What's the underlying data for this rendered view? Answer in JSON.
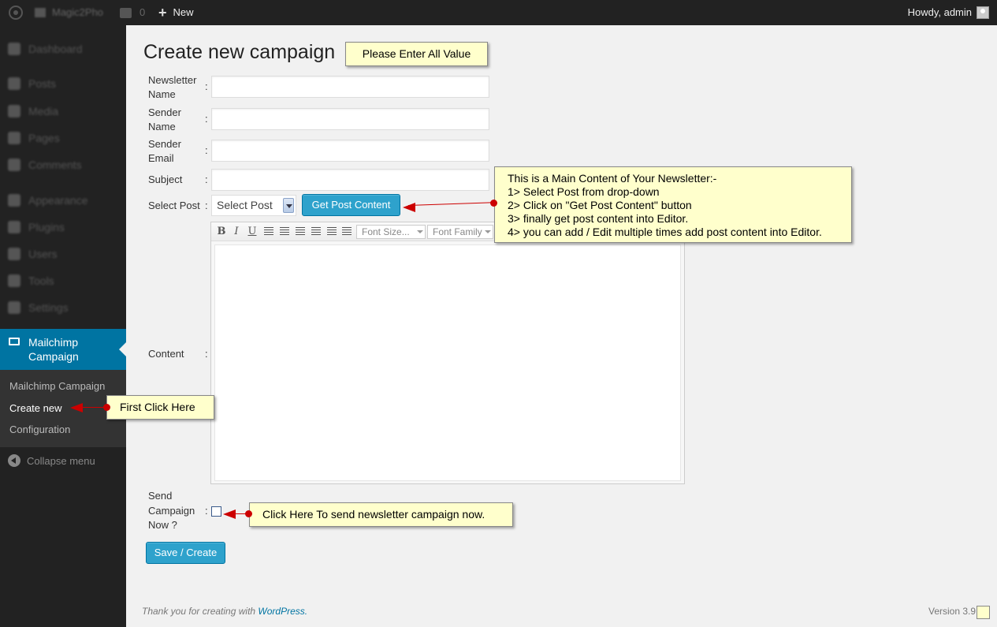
{
  "adminbar": {
    "site_name": "Magic2Pho",
    "comments_count": "0",
    "new_label": "New",
    "greeting": "Howdy, admin"
  },
  "sidebar": {
    "items": [
      {
        "label": "Dashboard"
      },
      {
        "label": "Posts"
      },
      {
        "label": "Media"
      },
      {
        "label": "Pages"
      },
      {
        "label": "Comments"
      },
      {
        "label": "Appearance"
      },
      {
        "label": "Plugins"
      },
      {
        "label": "Users"
      },
      {
        "label": "Tools"
      },
      {
        "label": "Settings"
      }
    ],
    "active": {
      "label": "Mailchimp Campaign"
    },
    "submenu": [
      {
        "label": "Mailchimp Campaign"
      },
      {
        "label": "Create new"
      },
      {
        "label": "Configuration"
      }
    ],
    "collapse_label": "Collapse menu"
  },
  "page": {
    "title": "Create new campaign",
    "fields": {
      "newsletter_name_label": "Newsletter Name",
      "sender_name_label": "Sender Name",
      "sender_email_label": "Sender Email",
      "subject_label": "Subject",
      "select_post_label": "Select Post",
      "content_label": "Content",
      "send_now_label": "Send Campaign Now ?",
      "colon": ":"
    },
    "select_post_value": "Select Post",
    "get_post_button": "Get Post Content",
    "save_button": "Save / Create",
    "editor": {
      "bold": "B",
      "italic": "I",
      "underline": "U",
      "font_size": "Font Size...",
      "font_family": "Font Family"
    }
  },
  "callouts": {
    "enter_all": "Please Enter All Value",
    "main_content": [
      "This is a Main Content of Your Newsletter:-",
      "1> Select Post from drop-down",
      "2> Click on \"Get Post Content\" button",
      "3> finally get post content into Editor.",
      "4> you can add / Edit multiple times add post content into Editor."
    ],
    "first_click": "First Click Here",
    "send_now": "Click Here To send newsletter campaign now."
  },
  "footer": {
    "thanks_prefix": "Thank you for creating with",
    "wordpress_link": "WordPress.",
    "version": "Version 3.9"
  },
  "colors": {
    "adminbar_bg": "#222222",
    "accent": "#0074a2",
    "button": "#2ea2cc",
    "callout_bg": "#ffffcc",
    "arrow": "#cc0000"
  }
}
